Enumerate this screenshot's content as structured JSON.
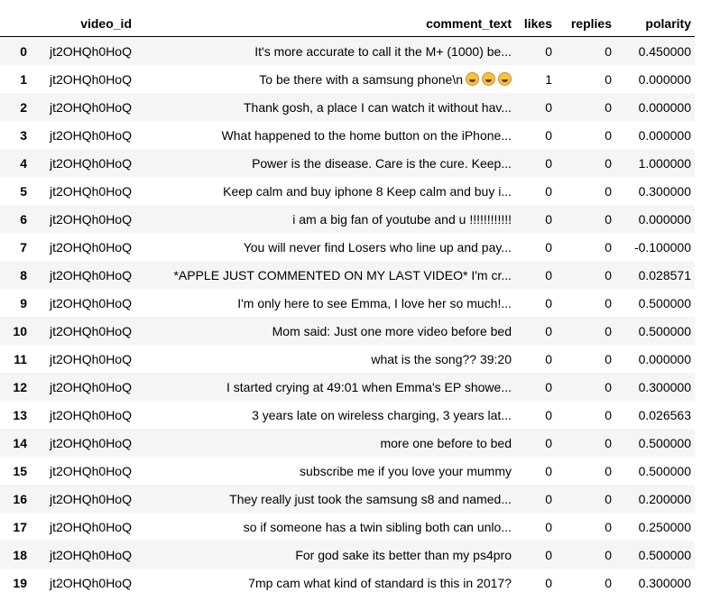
{
  "table": {
    "columns": [
      "",
      "video_id",
      "comment_text",
      "likes",
      "replies",
      "polarity"
    ],
    "rows": [
      {
        "index": "0",
        "video_id": "jt2OHQh0HoQ",
        "comment_text": "It's more accurate to call it the M+ (1000) be...",
        "likes": "0",
        "replies": "0",
        "polarity": "0.450000"
      },
      {
        "index": "1",
        "video_id": "jt2OHQh0HoQ",
        "comment_text": "To be there with a samsung phone\\n",
        "emoji_count": 3,
        "emoji_icon": "grinning-sweat-face-icon",
        "likes": "1",
        "replies": "0",
        "polarity": "0.000000"
      },
      {
        "index": "2",
        "video_id": "jt2OHQh0HoQ",
        "comment_text": "Thank gosh, a place I can watch it without hav...",
        "likes": "0",
        "replies": "0",
        "polarity": "0.000000"
      },
      {
        "index": "3",
        "video_id": "jt2OHQh0HoQ",
        "comment_text": "What happened to the home button on the iPhone...",
        "likes": "0",
        "replies": "0",
        "polarity": "0.000000"
      },
      {
        "index": "4",
        "video_id": "jt2OHQh0HoQ",
        "comment_text": "Power is the disease.  Care is the cure.  Keep...",
        "likes": "0",
        "replies": "0",
        "polarity": "1.000000"
      },
      {
        "index": "5",
        "video_id": "jt2OHQh0HoQ",
        "comment_text": "Keep calm and buy iphone 8 Keep calm and buy i...",
        "likes": "0",
        "replies": "0",
        "polarity": "0.300000"
      },
      {
        "index": "6",
        "video_id": "jt2OHQh0HoQ",
        "comment_text": "i am a big fan of youtube and u !!!!!!!!!!!!",
        "likes": "0",
        "replies": "0",
        "polarity": "0.000000"
      },
      {
        "index": "7",
        "video_id": "jt2OHQh0HoQ",
        "comment_text": "You will never find Losers who line up and pay...",
        "likes": "0",
        "replies": "0",
        "polarity": "-0.100000"
      },
      {
        "index": "8",
        "video_id": "jt2OHQh0HoQ",
        "comment_text": "*APPLE JUST COMMENTED ON MY LAST VIDEO* I'm cr...",
        "likes": "0",
        "replies": "0",
        "polarity": "0.028571"
      },
      {
        "index": "9",
        "video_id": "jt2OHQh0HoQ",
        "comment_text": "I'm only here to see Emma, I love her so much!...",
        "likes": "0",
        "replies": "0",
        "polarity": "0.500000"
      },
      {
        "index": "10",
        "video_id": "jt2OHQh0HoQ",
        "comment_text": "Mom said: Just one more video before bed",
        "likes": "0",
        "replies": "0",
        "polarity": "0.500000"
      },
      {
        "index": "11",
        "video_id": "jt2OHQh0HoQ",
        "comment_text": "what is the song?? 39:20",
        "likes": "0",
        "replies": "0",
        "polarity": "0.000000"
      },
      {
        "index": "12",
        "video_id": "jt2OHQh0HoQ",
        "comment_text": "I started crying at 49:01 when Emma's EP showe...",
        "likes": "0",
        "replies": "0",
        "polarity": "0.300000"
      },
      {
        "index": "13",
        "video_id": "jt2OHQh0HoQ",
        "comment_text": "3 years late on wireless charging, 3 years lat...",
        "likes": "0",
        "replies": "0",
        "polarity": "0.026563"
      },
      {
        "index": "14",
        "video_id": "jt2OHQh0HoQ",
        "comment_text": "more one before to bed",
        "likes": "0",
        "replies": "0",
        "polarity": "0.500000"
      },
      {
        "index": "15",
        "video_id": "jt2OHQh0HoQ",
        "comment_text": "subscribe me if you love your mummy",
        "likes": "0",
        "replies": "0",
        "polarity": "0.500000"
      },
      {
        "index": "16",
        "video_id": "jt2OHQh0HoQ",
        "comment_text": "They really just took the samsung s8 and named...",
        "likes": "0",
        "replies": "0",
        "polarity": "0.200000"
      },
      {
        "index": "17",
        "video_id": "jt2OHQh0HoQ",
        "comment_text": "so if someone has a twin sibling both can unlo...",
        "likes": "0",
        "replies": "0",
        "polarity": "0.250000"
      },
      {
        "index": "18",
        "video_id": "jt2OHQh0HoQ",
        "comment_text": "For god sake its better than my ps4pro",
        "likes": "0",
        "replies": "0",
        "polarity": "0.500000"
      },
      {
        "index": "19",
        "video_id": "jt2OHQh0HoQ",
        "comment_text": "7mp cam what kind of standard is this in 2017?",
        "likes": "0",
        "replies": "0",
        "polarity": "0.300000"
      }
    ]
  }
}
